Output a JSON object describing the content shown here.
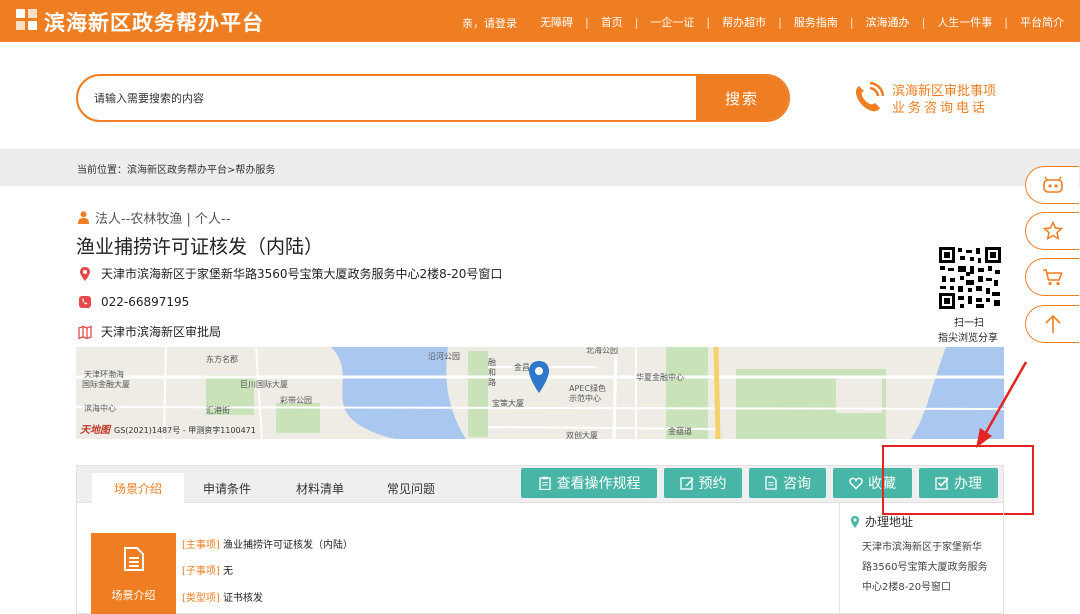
{
  "header": {
    "site_title": "滨海新区政务帮办平台",
    "login": "亲，请登录",
    "nav": [
      "无障碍",
      "首页",
      "一企一证",
      "帮办超市",
      "服务指南",
      "滨海通办",
      "人生一件事",
      "平台简介"
    ]
  },
  "search": {
    "placeholder": "请输入需要搜索的内容",
    "button": "搜索"
  },
  "hotline": {
    "line1": "滨海新区审批事项",
    "line2": "业务咨询电话"
  },
  "breadcrumb": "当前位置：滨海新区政务帮办平台>帮办服务",
  "item": {
    "category": "法人--农林牧渔 | 个人--",
    "title": "渔业捕捞许可证核发（内陆）",
    "address": "天津市滨海新区于家堡新华路3560号宝策大厦政务服务中心2楼8-20号窗口",
    "phone": "022-66897195",
    "department": "天津市滨海新区审批局"
  },
  "qr": {
    "line1": "扫一扫",
    "line2": "指尖浏览分享"
  },
  "map": {
    "labels": [
      "东方名郡",
      "天津环渤海",
      "国际金融大厦",
      "巨川国际大厦",
      "彩带公园",
      "汇港街",
      "滨海中心",
      "沿河公园",
      "融",
      "和",
      "路",
      "金昌",
      "北海公园",
      "华夏金融中心",
      "APEC绿色",
      "示范中心",
      "宝策大厦",
      "双创大厦",
      "金蕴道"
    ],
    "copyright": "GS(2021)1487号 - 甲测资字1100471",
    "logo_text": "天地图"
  },
  "tabs": [
    "场景介绍",
    "申请条件",
    "材料清单",
    "常见问题"
  ],
  "actions": [
    "查看操作规程",
    "预约",
    "咨询",
    "收藏",
    "办理"
  ],
  "scene": {
    "card_label": "场景介绍",
    "rows": [
      {
        "key": "[主事项]",
        "value": "渔业捕捞许可证核发（内陆）"
      },
      {
        "key": "[子事项]",
        "value": "无"
      },
      {
        "key": "[类型项]",
        "value": "证书核发"
      }
    ]
  },
  "side": {
    "title": "办理地址",
    "address": "天津市滨海新区于家堡新华路3560号宝策大厦政务服务中心2楼8-20号窗口"
  },
  "float_tools": [
    "robot-icon",
    "star-icon",
    "cart-icon",
    "back-to-top-icon"
  ],
  "colors": {
    "brand": "#ef7d22",
    "action": "#48b6a6",
    "highlight": "#e52320"
  }
}
